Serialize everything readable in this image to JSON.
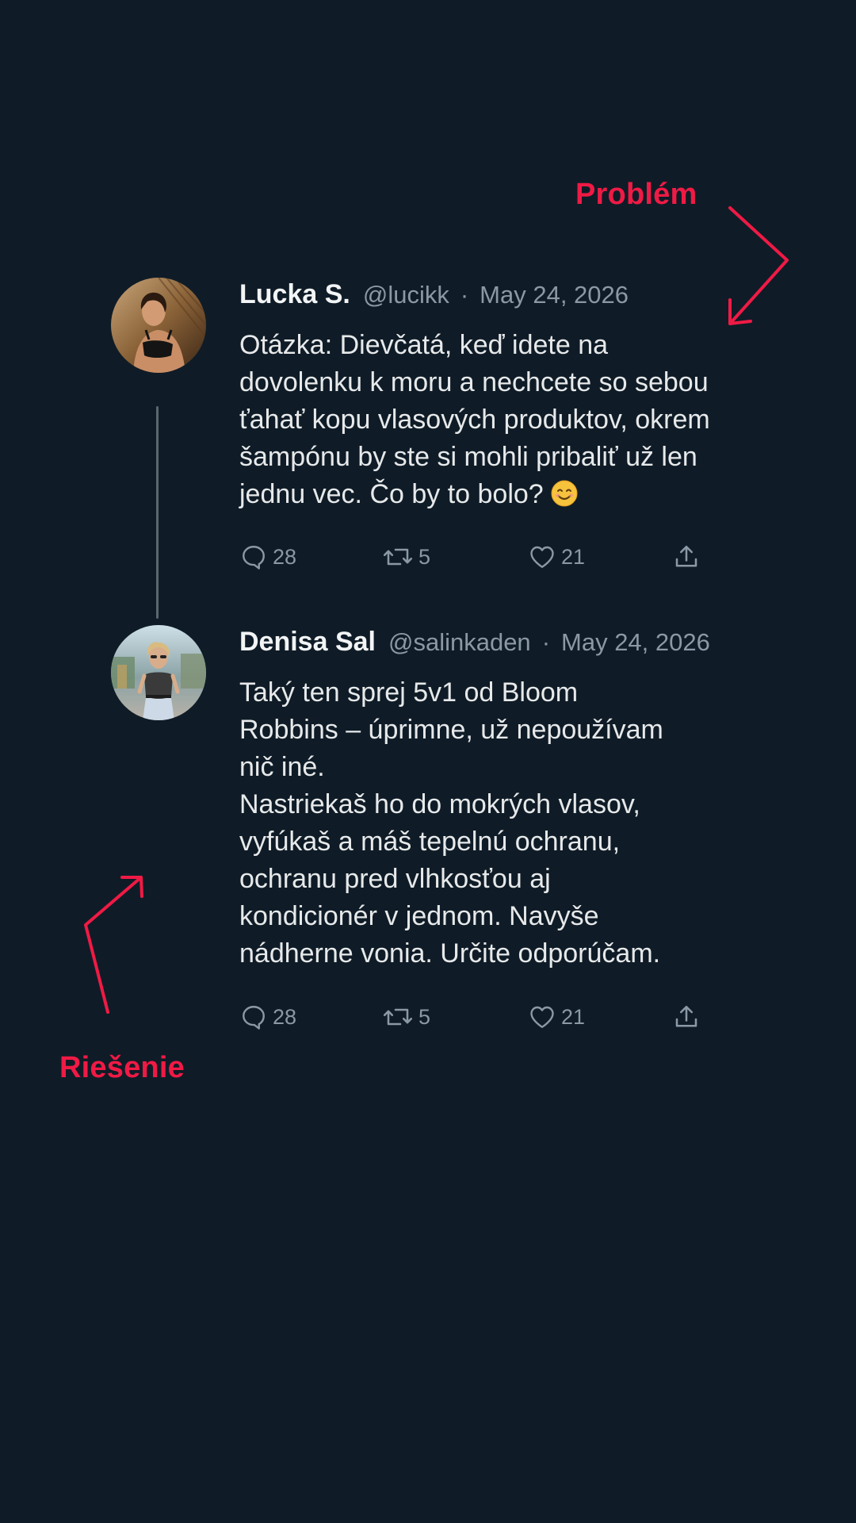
{
  "annotations": {
    "problem_label": "Problém",
    "solution_label": "Riešenie",
    "accent_color": "#f01a45"
  },
  "tweets": [
    {
      "name": "Lucka S.",
      "handle": "@lucikk",
      "separator": "·",
      "date": "May 24, 2026",
      "text": "Otázka: Dievčatá, keď idete na\ndovolenku k moru a nechcete so sebou\nťahať kopu vlasových produktov, okrem\nšampónu by ste si mohli pribaliť už len\njednu vec. Čo by to bolo?",
      "emoji": "smiling-face-emoji",
      "replies": "28",
      "retweets": "5",
      "likes": "21"
    },
    {
      "name": "Denisa Sal",
      "handle": "@salinkaden",
      "separator": "·",
      "date": "May 24, 2026",
      "text": "Taký ten sprej 5v1 od Bloom\nRobbins – úprimne, už nepoužívam\nnič iné.\nNastriekaš ho do mokrých vlasov,\nvyfúkaš a máš tepelnú ochranu,\nochranu pred vlhkosťou aj\nkondicionér v jednom. Navyše\nnádherne vonia. Určite odporúčam.",
      "replies": "28",
      "retweets": "5",
      "likes": "21"
    }
  ],
  "icons": [
    "reply-icon",
    "retweet-icon",
    "like-icon",
    "share-icon"
  ],
  "colors": {
    "background": "#0f1c27",
    "text": "#e7e9ea",
    "muted": "#8b98a5"
  }
}
